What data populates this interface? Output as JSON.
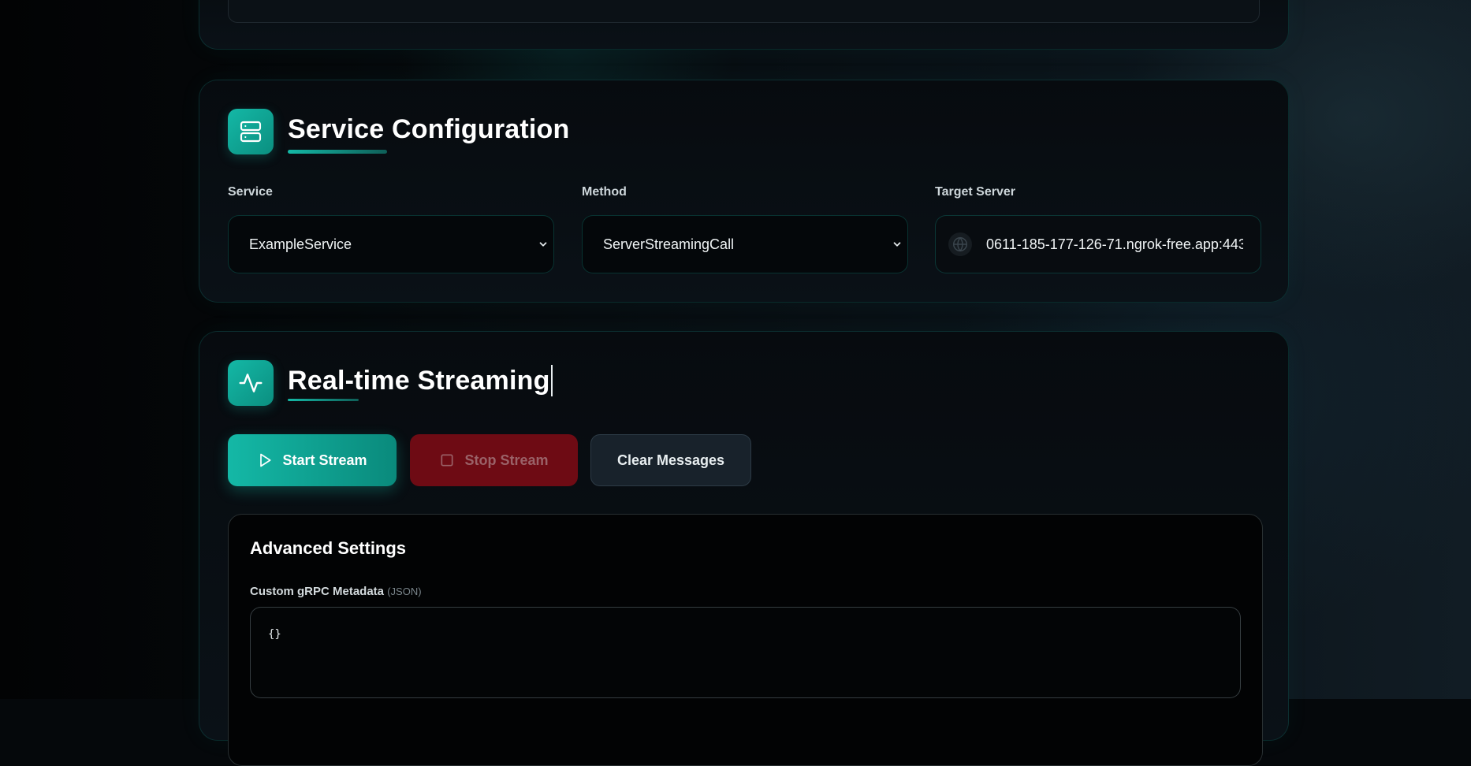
{
  "service_config": {
    "title": "Service Configuration",
    "service_label": "Service",
    "service_value": "ExampleService",
    "method_label": "Method",
    "method_value": "ServerStreamingCall",
    "target_label": "Target Server",
    "target_value": "0611-185-177-126-71.ngrok-free.app:443"
  },
  "streaming": {
    "title": "Real-time Streaming",
    "start_label": "Start Stream",
    "stop_label": "Stop Stream",
    "clear_label": "Clear Messages",
    "advanced": {
      "title": "Advanced Settings",
      "metadata_label": "Custom gRPC Metadata",
      "metadata_hint": "(JSON)",
      "metadata_value": "{}"
    }
  },
  "colors": {
    "accent": "#14b8a6",
    "stop": "#6e0b14",
    "background": "#05080b"
  },
  "icons": [
    "server-icon",
    "activity-icon",
    "chevron-down-icon",
    "globe-icon",
    "play-icon",
    "stop-square-icon"
  ]
}
